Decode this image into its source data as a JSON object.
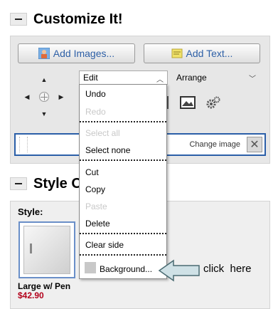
{
  "customize": {
    "title": "Customize It!",
    "add_images_label": "Add Images...",
    "add_text_label": "Add Text...",
    "edit_select_value": "Edit",
    "arrange_select_value": "Arrange",
    "change_image_label": "Change image",
    "close_glyph": "✕"
  },
  "edit_menu": {
    "items": [
      {
        "label": "Undo",
        "enabled": true
      },
      {
        "label": "Redo",
        "enabled": false
      },
      {
        "label": "Select all",
        "enabled": false
      },
      {
        "label": "Select none",
        "enabled": true
      },
      {
        "label": "Cut",
        "enabled": true
      },
      {
        "label": "Copy",
        "enabled": true
      },
      {
        "label": "Paste",
        "enabled": false
      },
      {
        "label": "Delete",
        "enabled": true
      },
      {
        "label": "Clear side",
        "enabled": true
      },
      {
        "label": "Background...",
        "enabled": true
      }
    ]
  },
  "style": {
    "title": "Style Options",
    "style_label": "Style:",
    "product_name": "Large w/ Pen",
    "product_price": "$42.90"
  },
  "annotation": {
    "text": "click  here"
  },
  "colors": {
    "link_blue": "#2d5fa6",
    "price_red": "#b3001b",
    "highlight_border": "#2b5fa8"
  }
}
